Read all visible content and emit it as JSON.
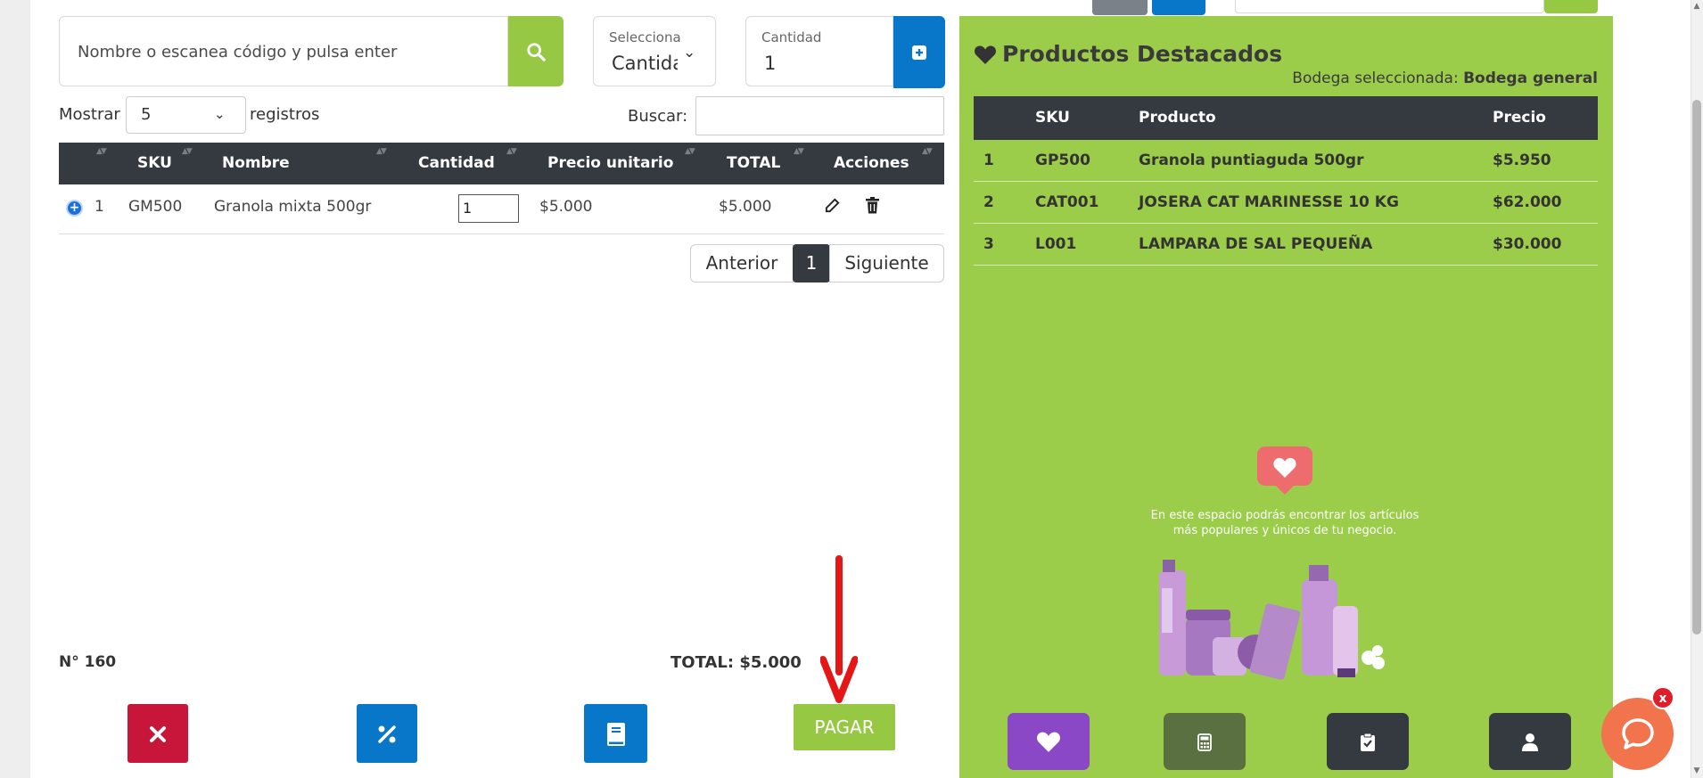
{
  "search": {
    "placeholder": "Nombre o escanea código y pulsa enter"
  },
  "unit_select": {
    "label": "Selecciona",
    "value": "Cantidad"
  },
  "quantity": {
    "label": "Cantidad",
    "value": "1"
  },
  "table_controls": {
    "show_label": "Mostrar",
    "show_value": "5",
    "records_label": "registros",
    "search_label": "Buscar:",
    "search_value": ""
  },
  "cart_table": {
    "headers": [
      "SKU",
      "Nombre",
      "Cantidad",
      "Precio unitario",
      "TOTAL",
      "Acciones"
    ],
    "rows": [
      {
        "index": "1",
        "sku": "GM500",
        "name": "Granola mixta 500gr",
        "qty": "1",
        "unit_price": "$5.000",
        "total": "$5.000"
      }
    ]
  },
  "pagination": {
    "prev": "Anterior",
    "page": "1",
    "next": "Siguiente"
  },
  "order": {
    "number": "N° 160",
    "total": "TOTAL: $5.000"
  },
  "actions": {
    "pay_label": "PAGAR"
  },
  "featured": {
    "title": "Productos Destacados",
    "warehouse_label": "Bodega seleccionada:",
    "warehouse_value": "Bodega general",
    "headers": [
      "SKU",
      "Producto",
      "Precio"
    ],
    "rows": [
      {
        "index": "1",
        "sku": "GP500",
        "product": "Granola puntiaguda 500gr",
        "price": "$5.950"
      },
      {
        "index": "2",
        "sku": "CAT001",
        "product": "JOSERA CAT MARINESSE 10 KG",
        "price": "$62.000"
      },
      {
        "index": "3",
        "sku": "L001",
        "product": "LAMPARA DE SAL PEQUEÑA",
        "price": "$30.000"
      }
    ],
    "empty_text_line1": "En este espacio podrás encontrar los artículos",
    "empty_text_line2": "más populares y únicos de tu negocio."
  },
  "chat": {
    "close_label": "x"
  },
  "colors": {
    "brand_green": "#97c843",
    "panel_green": "#9ccd4a",
    "primary_blue": "#0877c9",
    "danger_red": "#c8163a",
    "dark": "#343a40",
    "purple": "#8a48c6",
    "chat_orange": "#f1744d",
    "arrow_red": "#e51616"
  },
  "icons": [
    "search-icon",
    "chevron-down-icon",
    "plus-square-icon",
    "expand-row-icon",
    "edit-icon",
    "trash-icon",
    "close-icon",
    "percent-icon",
    "book-icon",
    "heart-icon",
    "calculator-icon",
    "clipboard-check-icon",
    "user-icon",
    "chat-icon"
  ]
}
